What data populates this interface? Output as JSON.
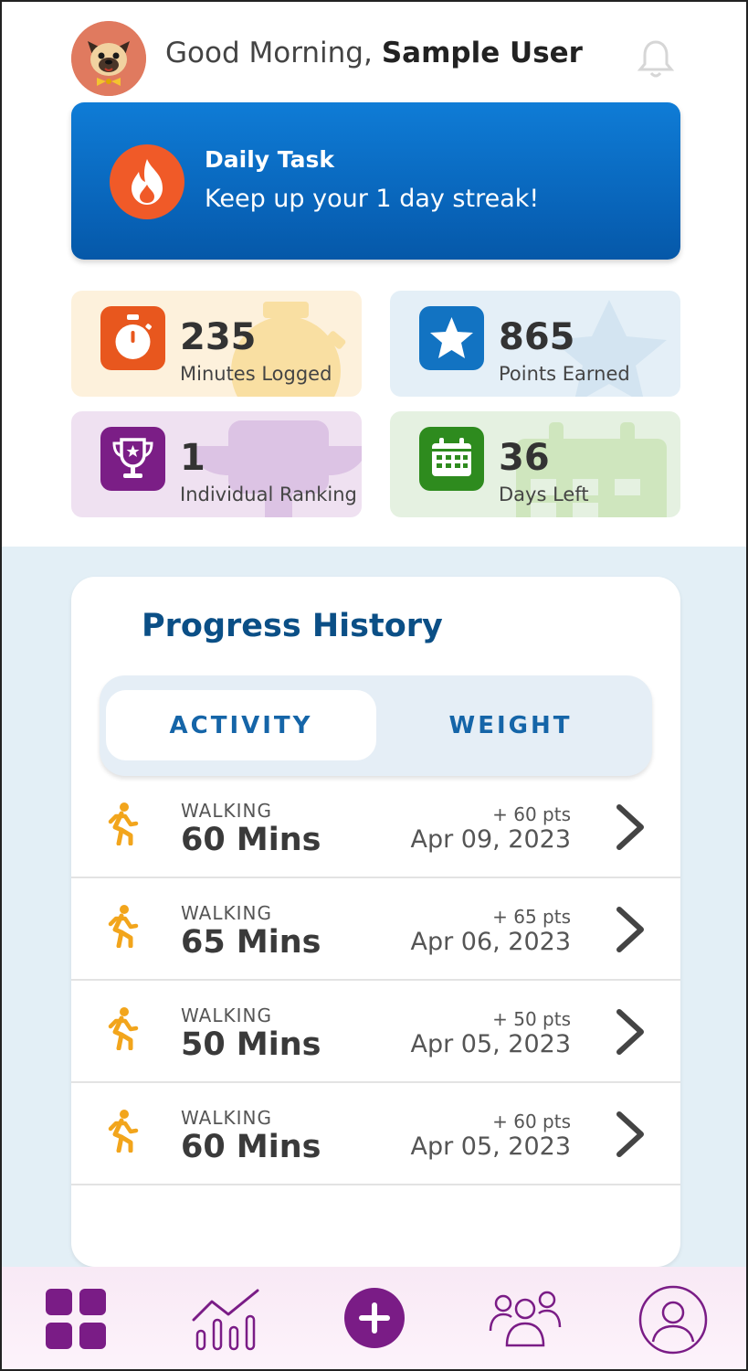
{
  "header": {
    "greeting": "Good Morning,",
    "user_name": "Sample User"
  },
  "daily_task": {
    "title": "Daily Task",
    "subtitle": "Keep up your 1 day streak!"
  },
  "stats": [
    {
      "value": "235",
      "label": "Minutes Logged",
      "icon": "stopwatch-icon",
      "color": "#e8571e",
      "bg": "#fdf1dc"
    },
    {
      "value": "865",
      "label": "Points Earned",
      "icon": "star-icon",
      "color": "#1273c2",
      "bg": "#e4eff7"
    },
    {
      "value": "1",
      "label": "Individual Ranking",
      "icon": "trophy-icon",
      "color": "#7b1e86",
      "bg": "#efe1f1"
    },
    {
      "value": "36",
      "label": "Days Left",
      "icon": "calendar-icon",
      "color": "#2e8b1e",
      "bg": "#e5f1e1"
    }
  ],
  "progress": {
    "title": "Progress History",
    "tabs": [
      {
        "label": "ACTIVITY",
        "active": true
      },
      {
        "label": "WEIGHT",
        "active": false
      }
    ],
    "entries": [
      {
        "activity": "WALKING",
        "duration": "60 Mins",
        "points": "+ 60 pts",
        "date": "Apr 09, 2023"
      },
      {
        "activity": "WALKING",
        "duration": "65 Mins",
        "points": "+ 65 pts",
        "date": "Apr 06, 2023"
      },
      {
        "activity": "WALKING",
        "duration": "50 Mins",
        "points": "+ 50 pts",
        "date": "Apr 05, 2023"
      },
      {
        "activity": "WALKING",
        "duration": "60 Mins",
        "points": "+ 60 pts",
        "date": "Apr 05, 2023"
      }
    ]
  },
  "nav": {
    "items": [
      "dashboard-icon",
      "stats-icon",
      "add-icon",
      "community-icon",
      "profile-icon"
    ],
    "accent": "#7a1c86"
  },
  "colors": {
    "primary_blue": "#0b6ac6",
    "title_blue": "#0b4f86",
    "activity_orange": "#f2a51c"
  }
}
